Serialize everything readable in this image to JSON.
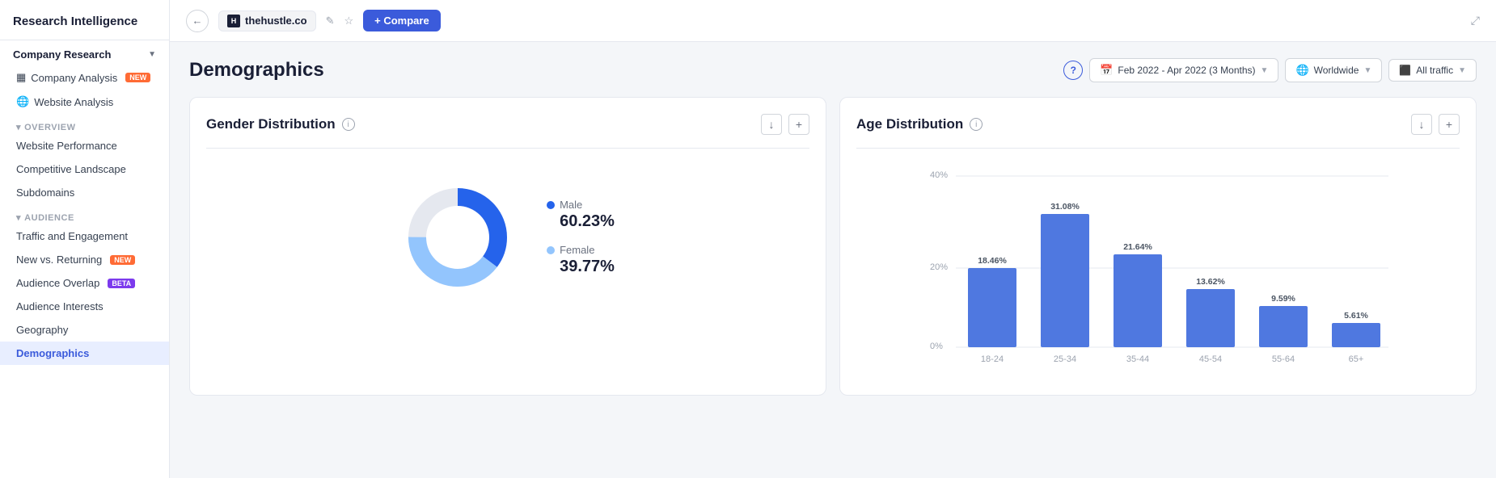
{
  "app": {
    "title": "Research Intelligence"
  },
  "header": {
    "back_label": "←",
    "site_name": "thehustle.co",
    "site_initial": "H",
    "edit_icon": "✎",
    "star_icon": "☆",
    "compare_label": "+ Compare",
    "expand_icon": "⤢"
  },
  "sidebar": {
    "title": "Research Intelligence",
    "sections": [
      {
        "label": "Company Research",
        "expanded": true,
        "items": [
          {
            "label": "Company Analysis",
            "badge": "NEW",
            "badge_type": "new",
            "icon": "grid",
            "active": false
          },
          {
            "label": "Website Analysis",
            "badge": null,
            "icon": "globe",
            "active": false
          }
        ]
      }
    ],
    "overview_label": "Overview",
    "overview_items": [
      {
        "label": "Website Performance",
        "active": false
      },
      {
        "label": "Competitive Landscape",
        "active": false
      },
      {
        "label": "Subdomains",
        "active": false
      }
    ],
    "audience_label": "Audience",
    "audience_items": [
      {
        "label": "Traffic and Engagement",
        "active": false
      },
      {
        "label": "New vs. Returning",
        "badge": "NEW",
        "badge_type": "new",
        "active": false
      },
      {
        "label": "Audience Overlap",
        "badge": "BETA",
        "badge_type": "beta",
        "active": false
      },
      {
        "label": "Audience Interests",
        "active": false
      },
      {
        "label": "Geography",
        "active": false
      },
      {
        "label": "Demographics",
        "active": true
      }
    ]
  },
  "page": {
    "title": "Demographics",
    "help_label": "?",
    "date_filter": "Feb 2022 - Apr 2022 (3 Months)",
    "date_icon": "📅",
    "geo_filter": "Worldwide",
    "geo_icon": "🌐",
    "traffic_filter": "All traffic",
    "traffic_icon": "📊"
  },
  "gender_chart": {
    "title": "Gender Distribution",
    "download_label": "↓",
    "add_label": "+",
    "male_label": "Male",
    "male_pct": "60.23%",
    "female_label": "Female",
    "female_pct": "39.77%",
    "male_color": "#2563eb",
    "female_color": "#93c5fd",
    "male_ratio": 0.6023,
    "female_ratio": 0.3977
  },
  "age_chart": {
    "title": "Age Distribution",
    "download_label": "↓",
    "add_label": "+",
    "y_labels": [
      "40%",
      "20%",
      "0%"
    ],
    "bars": [
      {
        "label": "18-24",
        "value": 18.46,
        "pct": "18.46%"
      },
      {
        "label": "25-34",
        "value": 31.08,
        "pct": "31.08%"
      },
      {
        "label": "35-44",
        "value": 21.64,
        "pct": "21.64%"
      },
      {
        "label": "45-54",
        "value": 13.62,
        "pct": "13.62%"
      },
      {
        "label": "55-64",
        "value": 9.59,
        "pct": "9.59%"
      },
      {
        "label": "65+",
        "value": 5.61,
        "pct": "5.61%"
      }
    ],
    "max_value": 40,
    "bar_color": "#4f78e0"
  }
}
